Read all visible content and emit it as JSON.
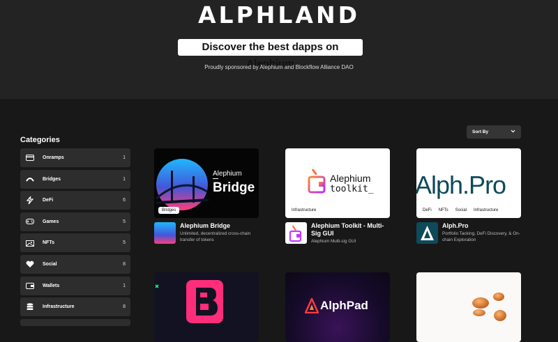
{
  "header": {
    "logo": "ALPHLAND",
    "tagline": "Discover the best dapps on Alephium",
    "sponsor": "Proudly sponsored by Alephium and Blockflow Alliance DAO"
  },
  "categories": {
    "title": "Categories",
    "items": [
      {
        "label": "Onramps",
        "count": "1",
        "icon": "card-icon"
      },
      {
        "label": "Bridges",
        "count": "1",
        "icon": "bridge-icon"
      },
      {
        "label": "DeFi",
        "count": "6",
        "icon": "defi-icon"
      },
      {
        "label": "Games",
        "count": "5",
        "icon": "gamepad-icon"
      },
      {
        "label": "NFTs",
        "count": "5",
        "icon": "nft-icon"
      },
      {
        "label": "Social",
        "count": "8",
        "icon": "heart-icon"
      },
      {
        "label": "Wallets",
        "count": "1",
        "icon": "wallet-icon"
      },
      {
        "label": "Infrastructure",
        "count": "8",
        "icon": "database-icon"
      }
    ]
  },
  "sort": {
    "label": "Sort By"
  },
  "cards": [
    {
      "name": "Alephium Bridge",
      "desc": "Unlimited, decentralized cross-chain transfer of tokens",
      "tags": [
        "Bridges"
      ],
      "thumb_title": "Alephium",
      "thumb_big": "Bridge"
    },
    {
      "name": "Alephium Toolkit - Multi-Sig GUI",
      "desc": "Alephium Multi-sig GUI",
      "tags": [
        "Infrastructure"
      ],
      "thumb_title": "Alephium",
      "thumb_big": "toolkit_"
    },
    {
      "name": "Alph.Pro",
      "desc": "Portfolio Tacking, DeFi Discovery, & On-chain Exploration",
      "tags": [
        "DeFi",
        "NFTs",
        "Social",
        "Infrastructure"
      ],
      "thumb_big": "Alph.Pro"
    },
    {
      "name": "",
      "desc": "",
      "tags": [],
      "thumb_big": ""
    },
    {
      "name": "",
      "desc": "",
      "tags": [],
      "thumb_big": "AlphPad"
    },
    {
      "name": "",
      "desc": "",
      "tags": [],
      "thumb_big": ""
    }
  ],
  "colors": {
    "bg": "#181818",
    "hero": "#232323",
    "item": "#2d2d2d",
    "accent_pink": "#ff2d7a",
    "alphpro_teal": "#0e4a5a"
  }
}
